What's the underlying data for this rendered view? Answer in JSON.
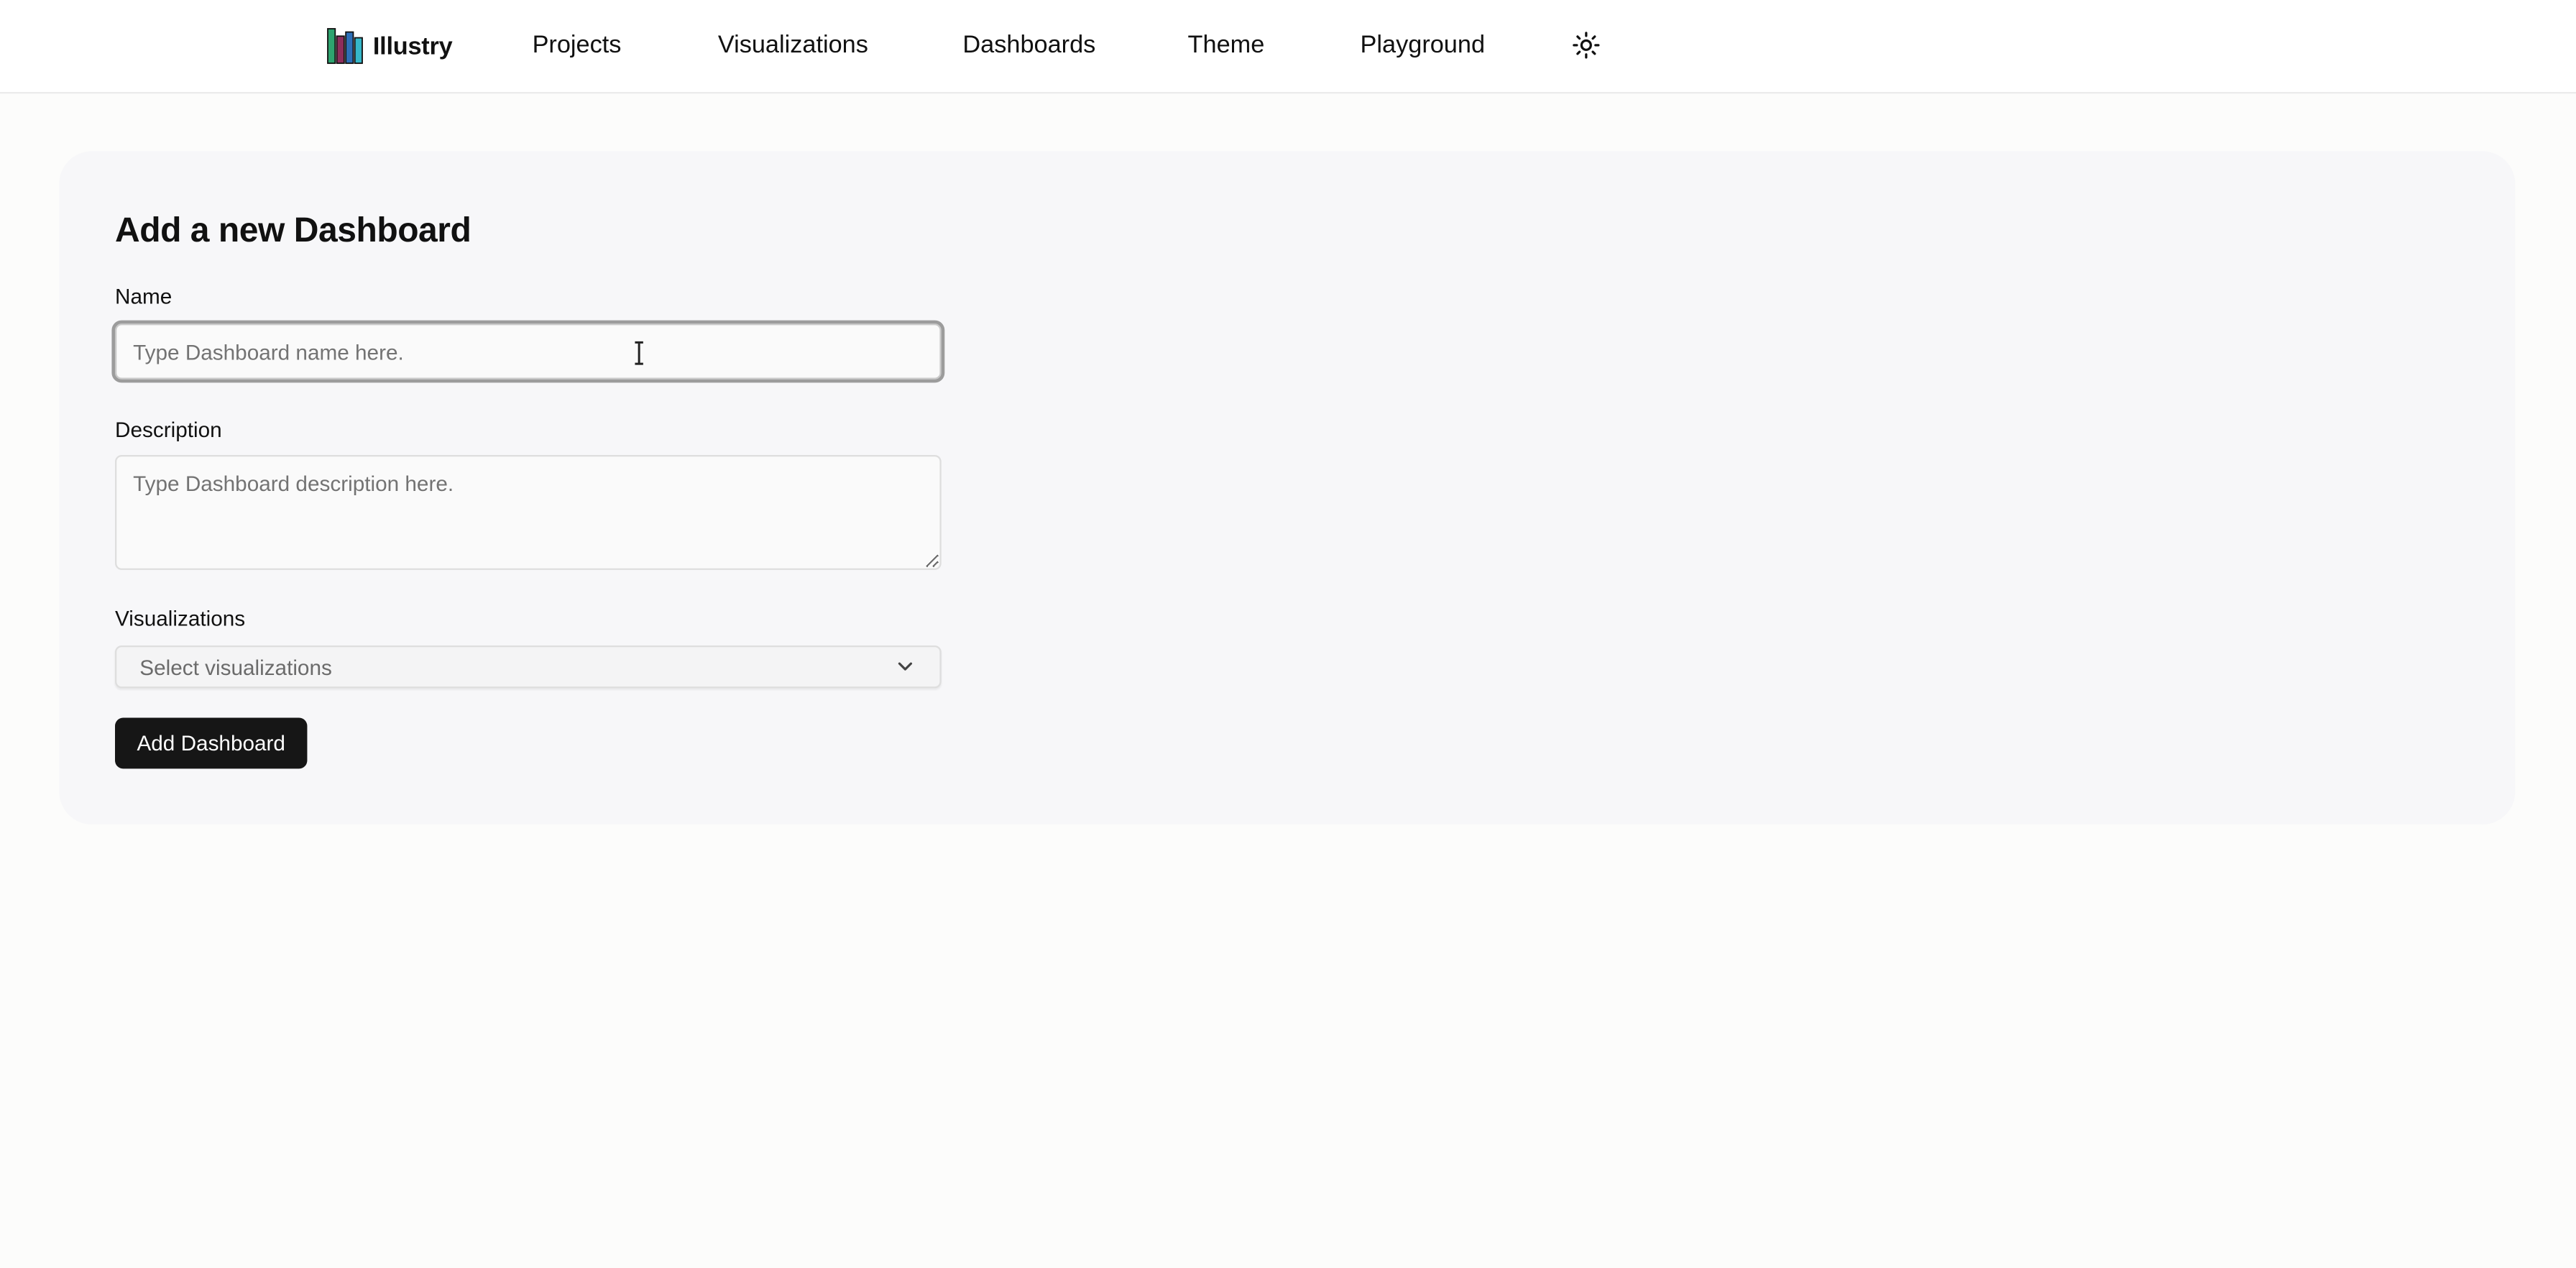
{
  "header": {
    "brand_name": "Illustry",
    "nav": [
      {
        "label": "Projects"
      },
      {
        "label": "Visualizations"
      },
      {
        "label": "Dashboards"
      },
      {
        "label": "Theme"
      },
      {
        "label": "Playground"
      }
    ],
    "theme_toggle_icon": "sun-icon"
  },
  "form": {
    "title": "Add a new Dashboard",
    "name": {
      "label": "Name",
      "value": "",
      "placeholder": "Type Dashboard name here."
    },
    "description": {
      "label": "Description",
      "value": "",
      "placeholder": "Type Dashboard description here."
    },
    "visualizations": {
      "label": "Visualizations",
      "placeholder": "Select visualizations",
      "icon": "chevron-down-icon"
    },
    "submit_label": "Add Dashboard"
  },
  "colors": {
    "logo_bars": [
      "#2ea36f",
      "#8e2d5c",
      "#2d6fb8",
      "#35b7c9"
    ],
    "button_bg": "#161616",
    "card_bg": "#f7f7f9"
  }
}
